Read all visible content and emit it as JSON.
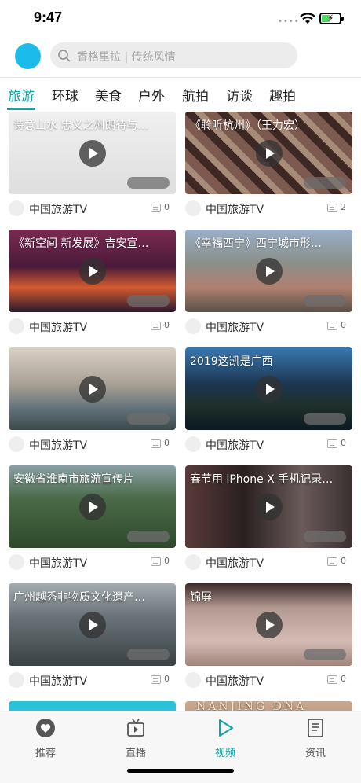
{
  "status_bar": {
    "time": "9:47"
  },
  "header": {
    "search_placeholder": "香格里拉 | 传统风情"
  },
  "tabs": [
    {
      "label": "旅游",
      "active": true
    },
    {
      "label": "环球"
    },
    {
      "label": "美食"
    },
    {
      "label": "户外"
    },
    {
      "label": "航拍"
    },
    {
      "label": "访谈"
    },
    {
      "label": "趣拍"
    }
  ],
  "videos": [
    {
      "title": "诗意山水 忠义之州朗待与…",
      "source": "中国旅游TV",
      "comments": "0",
      "bg": "#e8e8e8"
    },
    {
      "title": "《聆听杭州》（王力宏）",
      "source": "中国旅游TV",
      "comments": "2",
      "bg": "#5a3a32"
    },
    {
      "title": "《新空间 新发展》吉安宣…",
      "source": "中国旅游TV",
      "comments": "0",
      "bg": "#6b2438"
    },
    {
      "title": "《幸福西宁》西宁城市形…",
      "source": "中国旅游TV",
      "comments": "0",
      "bg": "#6d7b8a"
    },
    {
      "title": "",
      "source": "中国旅游TV",
      "comments": "0",
      "bg": "#a8a094"
    },
    {
      "title": "2019这凯是广西",
      "source": "中国旅游TV",
      "comments": "0",
      "bg": "#1c3550"
    },
    {
      "title": "安徽省淮南市旅游宣传片",
      "source": "中国旅游TV",
      "comments": "0",
      "bg": "#3f5a3a"
    },
    {
      "title": "春节用 iPhone X 手机记录…",
      "source": "中国旅游TV",
      "comments": "0",
      "bg": "#3a3030"
    },
    {
      "title": "广州越秀非物质文化遗产…",
      "source": "中国旅游TV",
      "comments": "0",
      "bg": "#4a5054"
    },
    {
      "title": "锦屏",
      "source": "中国旅游TV",
      "comments": "0",
      "bg": "#b29a92"
    },
    {
      "title": "",
      "source": "",
      "comments": "",
      "bg": "#28c2d8"
    },
    {
      "title": "NANJING DNA",
      "source": "",
      "comments": "",
      "bg": "#b89880"
    }
  ],
  "bottom_nav": [
    {
      "label": "推荐",
      "icon": "heart-icon"
    },
    {
      "label": "直播",
      "icon": "tv-icon"
    },
    {
      "label": "视频",
      "icon": "play-icon",
      "active": true
    },
    {
      "label": "资讯",
      "icon": "document-icon"
    }
  ],
  "colors": {
    "accent": "#11a3a6",
    "avatar": "#1cbcea"
  }
}
